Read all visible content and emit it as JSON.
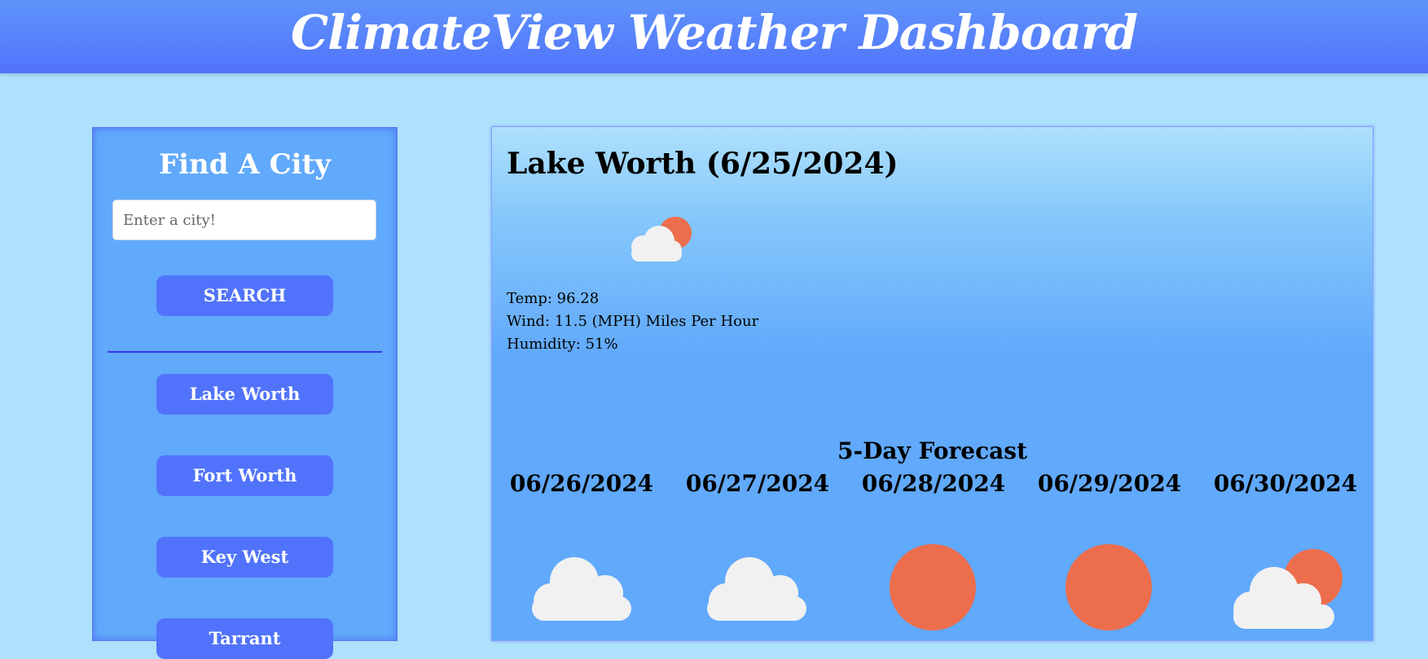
{
  "header": {
    "title": "ClimateView Weather Dashboard"
  },
  "sidebar": {
    "title": "Find A City",
    "search_placeholder": "Enter a city!",
    "search_button": "SEARCH",
    "history": [
      {
        "label": "Lake Worth"
      },
      {
        "label": "Fort Worth"
      },
      {
        "label": "Key West"
      },
      {
        "label": "Tarrant"
      }
    ]
  },
  "current": {
    "title": "Lake Worth (6/25/2024)",
    "icon": "few-clouds-icon",
    "temp": "Temp: 96.28",
    "wind": "Wind: 11.5 (MPH) Miles Per Hour",
    "humidity": "Humidity: 51%"
  },
  "forecast": {
    "title": "5-Day Forecast",
    "days": [
      {
        "date": "06/26/2024",
        "icon": "cloud-icon"
      },
      {
        "date": "06/27/2024",
        "icon": "cloud-icon"
      },
      {
        "date": "06/28/2024",
        "icon": "sun-icon"
      },
      {
        "date": "06/29/2024",
        "icon": "sun-icon"
      },
      {
        "date": "06/30/2024",
        "icon": "few-clouds-icon"
      }
    ]
  },
  "colors": {
    "header": "#5173fb",
    "background": "#ade1fc",
    "panel": "#61a9fb",
    "button": "#5173fb",
    "sun": "#ec6e4c",
    "cloud": "#f1f1f1"
  }
}
